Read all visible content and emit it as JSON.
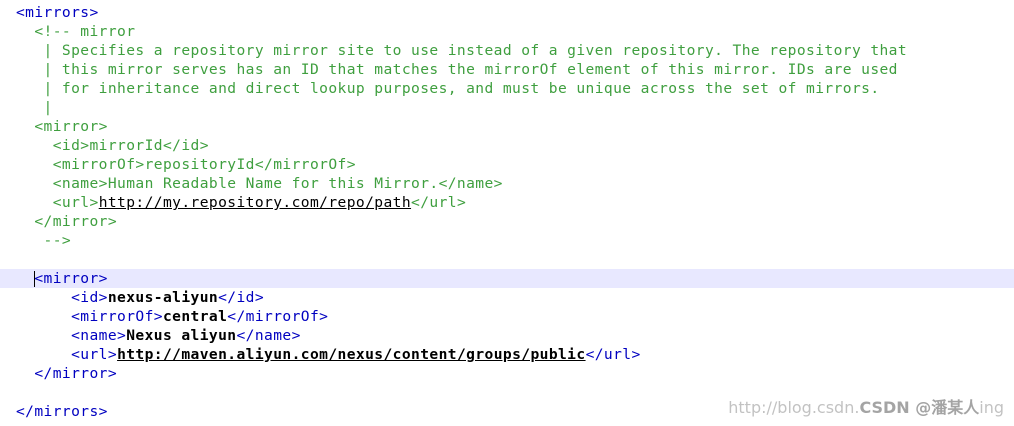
{
  "editor": {
    "lines": [
      {
        "text": "<mirrors>",
        "style": "tag"
      },
      {
        "text": "  <!-- mirror",
        "style": "comment"
      },
      {
        "text": "   | Specifies a repository mirror site to use instead of a given repository. The repository that",
        "style": "comment"
      },
      {
        "text": "   | this mirror serves has an ID that matches the mirrorOf element of this mirror. IDs are used",
        "style": "comment"
      },
      {
        "text": "   | for inheritance and direct lookup purposes, and must be unique across the set of mirrors.",
        "style": "comment"
      },
      {
        "text": "   |",
        "style": "comment"
      },
      {
        "text": "  <mirror>",
        "style": "comment"
      },
      {
        "text": "    <id>mirrorId</id>",
        "style": "comment"
      },
      {
        "text": "    <mirrorOf>repositoryId</mirrorOf>",
        "style": "comment"
      },
      {
        "text": "    <name>Human Readable Name for this Mirror.</name>",
        "style": "comment"
      },
      {
        "pre": "    <url>",
        "link": "http://my.repository.com/repo/path",
        "post": "</url>",
        "style": "comment-link"
      },
      {
        "text": "  </mirror>",
        "style": "comment"
      },
      {
        "text": "   -->",
        "style": "comment"
      },
      {
        "text": "",
        "style": "plain"
      },
      {
        "text": "  <mirror>",
        "style": "tag",
        "current": true
      },
      {
        "open": "      <id>",
        "value": "nexus-aliyun",
        "close": "</id>",
        "style": "tag-content"
      },
      {
        "open": "      <mirrorOf>",
        "value": "central",
        "close": "</mirrorOf>",
        "style": "tag-content"
      },
      {
        "open": "      <name>",
        "value": "Nexus aliyun",
        "close": "</name>",
        "style": "tag-content"
      },
      {
        "open": "      <url>",
        "link": "http://maven.aliyun.com/nexus/content/groups/public",
        "close": "</url>",
        "style": "tag-link"
      },
      {
        "text": "  </mirror>",
        "style": "tag"
      },
      {
        "text": "",
        "style": "plain"
      },
      {
        "text": "</mirrors>",
        "style": "tag"
      }
    ]
  },
  "watermark": {
    "url": "http://blog.csdn.",
    "brand": "CSDN @潘某人",
    "tail": "ing"
  },
  "colors": {
    "tag": "#0000c0",
    "comment": "#3f9f3f",
    "current_line": "#e8e8ff"
  }
}
